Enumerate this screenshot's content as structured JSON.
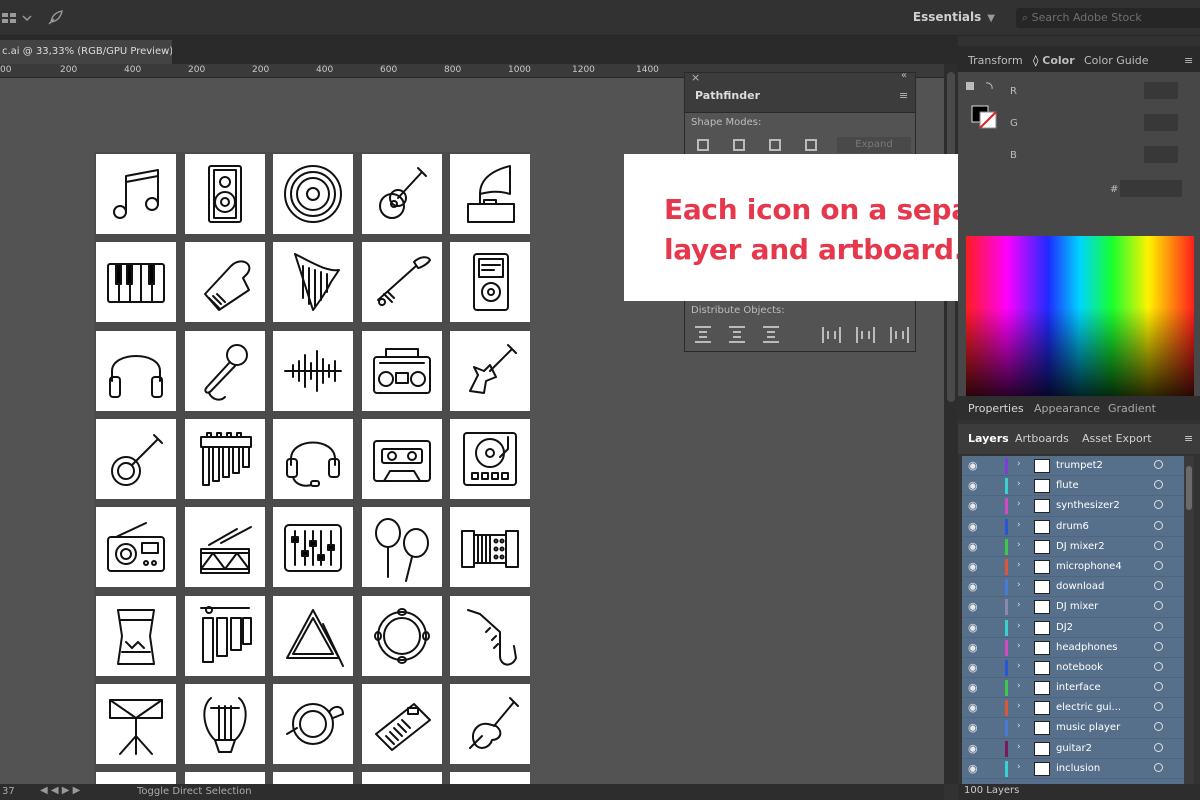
{
  "topbar": {
    "workspace": "Essentials",
    "search_placeholder": "Search Adobe Stock"
  },
  "document": {
    "tab_title": "c.ai @ 33,33% (RGB/GPU Preview)"
  },
  "ruler": {
    "ticks": [
      "200",
      "400",
      "200",
      "200",
      "400",
      "600",
      "800",
      "1000",
      "1200",
      "1400"
    ]
  },
  "status": {
    "zoom": "37",
    "tool": "Toggle Direct Selection"
  },
  "pathfinder": {
    "title": "Pathfinder",
    "shape_modes": "Shape Modes:",
    "expand": "Expand",
    "distribute": "Distribute Objects:"
  },
  "callout": {
    "text": "Each icon on a separate layer and artboard.",
    "color": "#e5384d"
  },
  "color_panel": {
    "tabs": [
      "Transform",
      "Color",
      "Color Guide"
    ],
    "active_tab": "Color",
    "channels": [
      "R",
      "G",
      "B"
    ],
    "hex_label": "#"
  },
  "props_tabs": [
    "Properties",
    "Appearance",
    "Gradient"
  ],
  "layers_tabs": [
    "Layers",
    "Artboards",
    "Asset Export"
  ],
  "layers": [
    {
      "name": "trumpet2",
      "color": "#7a3fd8"
    },
    {
      "name": "flute",
      "color": "#3ad1d1"
    },
    {
      "name": "synthesizer2",
      "color": "#d448c2"
    },
    {
      "name": "drum6",
      "color": "#2a55d6"
    },
    {
      "name": "DJ mixer2",
      "color": "#3ec84a"
    },
    {
      "name": "microphone4",
      "color": "#e0553a"
    },
    {
      "name": "download",
      "color": "#4a7ad8"
    },
    {
      "name": "DJ mixer",
      "color": "#8a8ab0"
    },
    {
      "name": "DJ2",
      "color": "#3ad1d1"
    },
    {
      "name": "headphones",
      "color": "#d448c2"
    },
    {
      "name": "notebook",
      "color": "#2a55d6"
    },
    {
      "name": "interface",
      "color": "#3ec84a"
    },
    {
      "name": "electric gui...",
      "color": "#e0553a"
    },
    {
      "name": "music player",
      "color": "#4a7ad8"
    },
    {
      "name": "guitar2",
      "color": "#7a1a5a"
    },
    {
      "name": "inclusion",
      "color": "#3ad1d1"
    }
  ],
  "layers_footer": "100 Layers",
  "icons": [
    [
      "music-note",
      "speaker",
      "vinyl-record",
      "acoustic-guitar",
      "gramophone"
    ],
    [
      "piano-keys",
      "grand-piano",
      "harp",
      "trumpet",
      "music-player"
    ],
    [
      "headphones",
      "microphone",
      "sound-wave",
      "boombox",
      "electric-guitar"
    ],
    [
      "banjo",
      "pan-flute",
      "headset",
      "cassette",
      "dj-turntable"
    ],
    [
      "radio",
      "snare-drum",
      "mixer-sliders",
      "maracas",
      "accordion"
    ],
    [
      "conga-drum",
      "xylophone",
      "triangle",
      "tambourine",
      "saxophone"
    ],
    [
      "drum-stand",
      "lyre",
      "french-horn",
      "keyboard-synth",
      "violin"
    ]
  ]
}
